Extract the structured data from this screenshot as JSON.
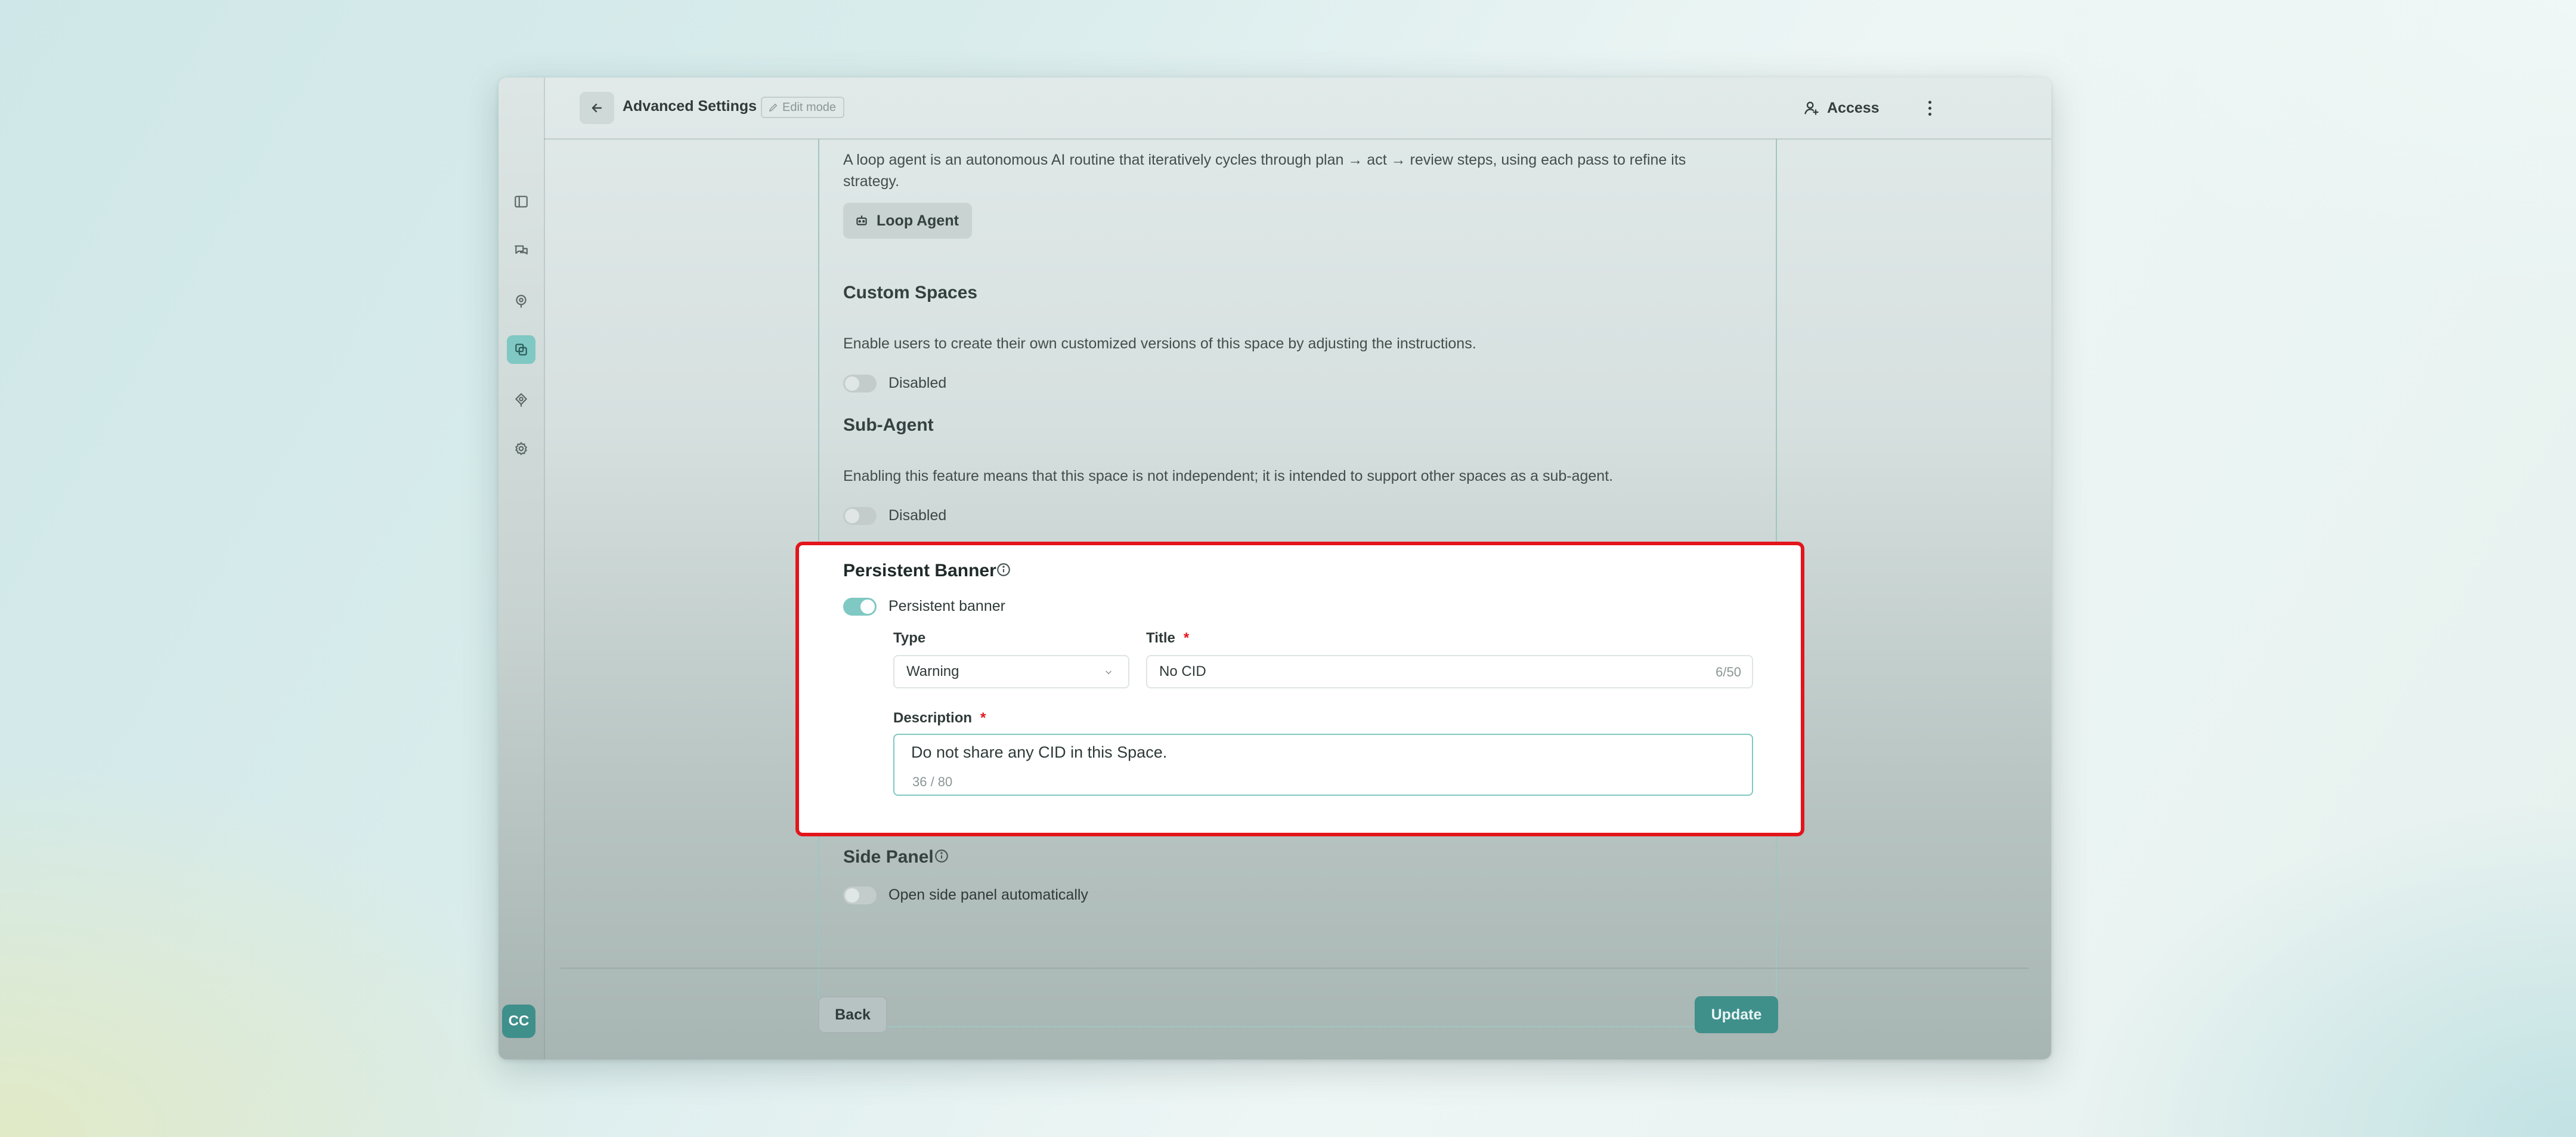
{
  "header": {
    "title": "Advanced Settings",
    "edit_badge": "Edit mode",
    "access_label": "Access"
  },
  "rail": {
    "icons": [
      "sidebar-toggle-icon",
      "chat-icon",
      "spaces-icon",
      "copy-spaces-icon",
      "agents-icon",
      "settings-icon"
    ],
    "active_index": 3,
    "avatar_initials": "CC"
  },
  "loop_agent": {
    "description": "A loop agent is an autonomous AI routine that iteratively cycles through plan → act → review steps, using each pass to refine its",
    "description_cont": "strategy.",
    "chip_label": "Loop Agent"
  },
  "custom_spaces": {
    "title": "Custom Spaces",
    "description": "Enable users to create their own customized versions of this space by adjusting the instructions.",
    "toggle_label": "Disabled",
    "enabled": false
  },
  "sub_agent": {
    "title": "Sub-Agent",
    "description": "Enabling this feature means that this space is not independent; it is intended to support other spaces as a sub-agent.",
    "toggle_label": "Disabled",
    "enabled": false
  },
  "persistent_banner": {
    "title": "Persistent Banner",
    "toggle_label": "Persistent banner",
    "enabled": true,
    "type_label": "Type",
    "type_value": "Warning",
    "title_label": "Title",
    "required_mark": "*",
    "title_value": "No CID",
    "title_counter": "6/50",
    "description_label": "Description",
    "description_value": "Do not share any CID in this Space.",
    "description_counter": "36 / 80"
  },
  "side_panel": {
    "title": "Side Panel",
    "toggle_label": "Open side panel automatically",
    "enabled": false
  },
  "footer": {
    "back_label": "Back",
    "update_label": "Update"
  },
  "colors": {
    "accent": "#3f8f8b",
    "toggle_on": "#7fc8c3",
    "highlight": "#e3151b"
  }
}
